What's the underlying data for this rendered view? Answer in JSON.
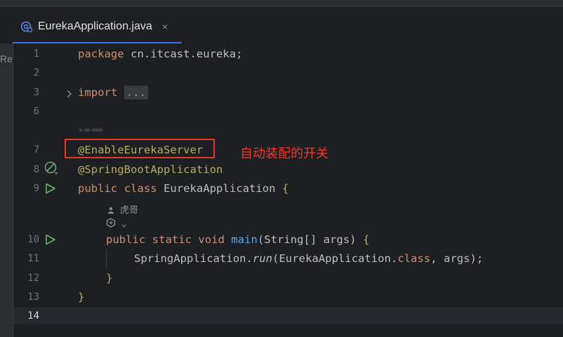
{
  "tab": {
    "label": "EurekaApplication.java",
    "close": "×"
  },
  "left_strip_label": "Re",
  "lines": [
    {
      "n": "1",
      "kind": "package",
      "kw": "package",
      "rest": " cn.itcast.eureka;"
    },
    {
      "n": "2"
    },
    {
      "n": "3",
      "kw": "import",
      "fold": "..."
    },
    {
      "n": "6"
    },
    {
      "n": "7",
      "annotation": "@EnableEurekaServer"
    },
    {
      "n": "8",
      "annotation": "@SpringBootApplication"
    },
    {
      "n": "9",
      "kw1": "public",
      "kw2": "class",
      "name": "EurekaApplication",
      "brace": "{"
    },
    {
      "n": "10",
      "kw1": "public",
      "kw2": "static",
      "kw3": "void",
      "method": "main",
      "args": "(String[] args) ",
      "brace": "{"
    },
    {
      "n": "11",
      "cls": "SpringApplication.",
      "call": "run",
      "open": "(EurekaApplication.",
      "kw": "class",
      "close": ", args);"
    },
    {
      "n": "12",
      "brace": "}"
    },
    {
      "n": "13",
      "brace": "}"
    },
    {
      "n": "14"
    }
  ],
  "inlay": {
    "author_icon": "person-icon",
    "author": "虎哥",
    "ai_icon": "ai-assistant-icon",
    "ai_chevron": "⌄"
  },
  "blurred_hint": "▪ ▪▪ ▪▪▪▪",
  "annotation_note": "自动装配的开关",
  "colors": {
    "accent": "#3574f0",
    "highlight": "#e23a2a",
    "keyword": "#cf8e6d",
    "annotation": "#b3ae60",
    "method": "#56a8f5"
  }
}
